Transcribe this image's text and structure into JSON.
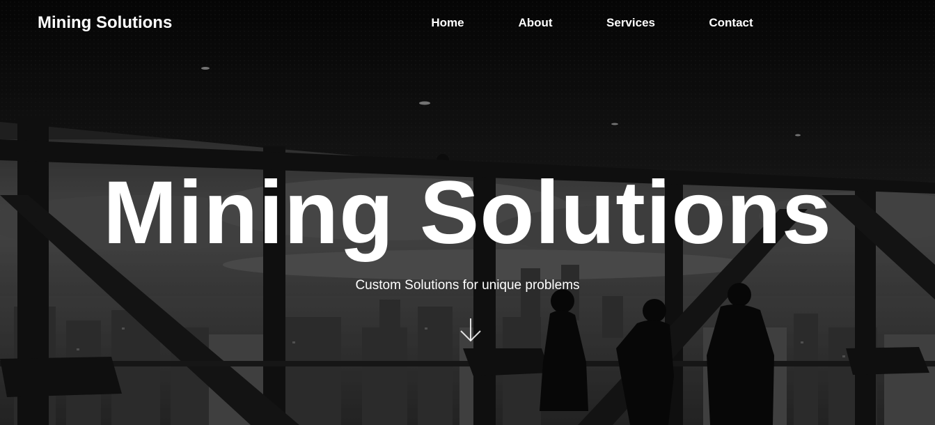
{
  "header": {
    "brand": "Mining Solutions",
    "nav": [
      {
        "label": "Home"
      },
      {
        "label": "About"
      },
      {
        "label": "Services"
      },
      {
        "label": "Contact"
      }
    ]
  },
  "hero": {
    "title": "Mining Solutions",
    "subtitle": "Custom Solutions for unique problems",
    "scroll_icon": "arrow-down-icon",
    "background": "grayscale photo of office interior with people silhouetted against city skyline windows"
  },
  "colors": {
    "text": "#ffffff",
    "overlay": "#000000"
  }
}
